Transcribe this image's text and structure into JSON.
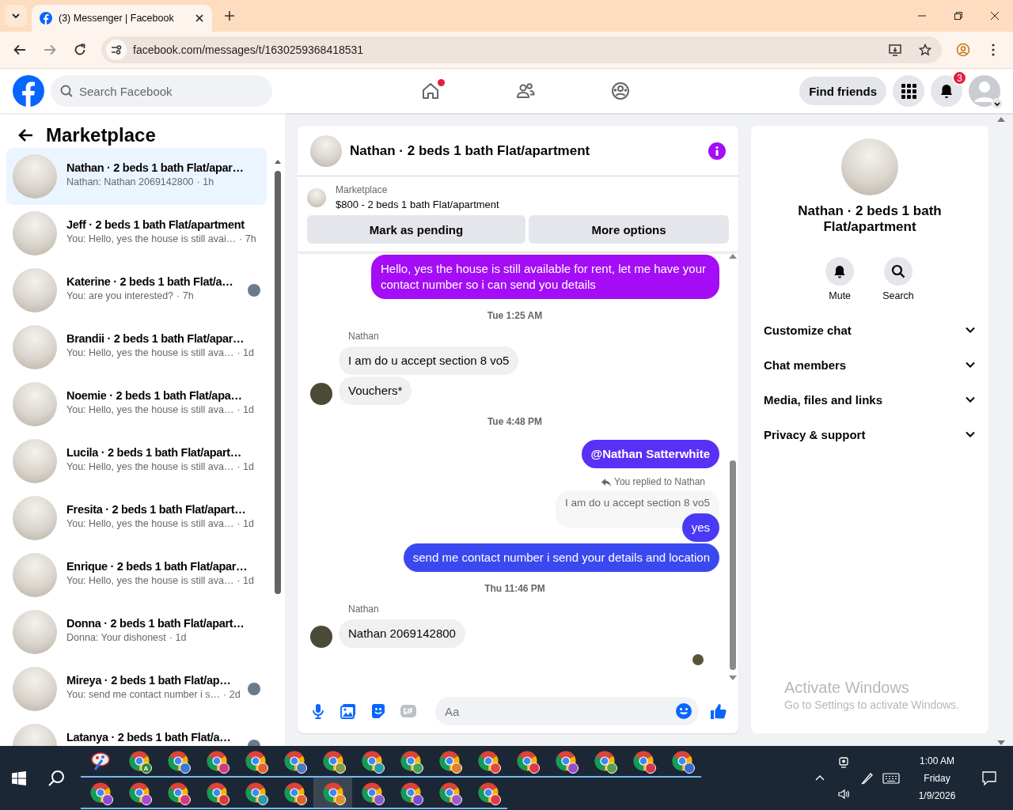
{
  "browser": {
    "tab": {
      "title": "(3) Messenger | Facebook",
      "selected": true
    },
    "url": "facebook.com/messages/t/1630259368418531"
  },
  "header": {
    "search": {
      "placeholder": "Search Facebook"
    },
    "home_notification": true,
    "find_friends": "Find friends",
    "notifications_badge": "3"
  },
  "sidebar": {
    "title": "Marketplace",
    "conversations": [
      {
        "name": "Nathan · 2 beds 1 bath Flat/apar…",
        "preview": "Nathan: Nathan 2069142800",
        "time": "· 1h",
        "selected": true,
        "read_receipt": false
      },
      {
        "name": "Jeff · 2 beds 1 bath Flat/apartment",
        "preview": "You: Hello, yes the house is still avai…",
        "time": "· 7h",
        "selected": false,
        "read_receipt": false
      },
      {
        "name": "Katerine · 2 beds 1 bath Flat/a…",
        "preview": "You: are you interested?",
        "time": "· 7h",
        "selected": false,
        "read_receipt": true
      },
      {
        "name": "Brandii · 2 beds 1 bath Flat/apar…",
        "preview": "You: Hello, yes the house is still ava…",
        "time": "· 1d",
        "selected": false,
        "read_receipt": false
      },
      {
        "name": "Noemie · 2 beds 1 bath Flat/apa…",
        "preview": "You: Hello, yes the house is still ava…",
        "time": "· 1d",
        "selected": false,
        "read_receipt": false
      },
      {
        "name": "Lucila · 2 beds 1 bath Flat/apart…",
        "preview": "You: Hello, yes the house is still ava…",
        "time": "· 1d",
        "selected": false,
        "read_receipt": false
      },
      {
        "name": "Fresita · 2 beds 1 bath Flat/apart…",
        "preview": "You: Hello, yes the house is still ava…",
        "time": "· 1d",
        "selected": false,
        "read_receipt": false
      },
      {
        "name": "Enrique · 2 beds 1 bath Flat/apar…",
        "preview": "You: Hello, yes the house is still ava…",
        "time": "· 1d",
        "selected": false,
        "read_receipt": false
      },
      {
        "name": "Donna · 2 beds 1 bath Flat/apart…",
        "preview": "Donna: Your dishonest",
        "time": "· 1d",
        "selected": false,
        "read_receipt": false
      },
      {
        "name": "Mireya · 2 beds 1 bath Flat/ap…",
        "preview": "You: send me contact number i s…",
        "time": "· 2d",
        "selected": false,
        "read_receipt": true
      },
      {
        "name": "Latanya · 2 beds 1 bath Flat/a…",
        "selected": false,
        "read_receipt": true
      }
    ]
  },
  "chat": {
    "title": "Nathan · 2 beds 1 bath Flat/apartment",
    "listing": {
      "label": "Marketplace",
      "title": "$800 - 2 beds 1 bath Flat/apartment",
      "buttons": [
        "Mark as pending",
        "More options"
      ]
    },
    "messages": [
      {
        "kind": "outgoing",
        "text": "Hello, yes the house is still available for rent, let me have your contact number so i can send you details",
        "color": "#a40df5"
      },
      {
        "kind": "timestamp",
        "text": "Tue 1:25 AM"
      },
      {
        "kind": "incoming",
        "sender": "Nathan",
        "bubbles": [
          "I am do u accept section 8 vo5",
          "Vouchers*"
        ]
      },
      {
        "kind": "timestamp",
        "text": "Tue 4:48 PM"
      },
      {
        "kind": "mention",
        "text": "@Nathan Satterwhite",
        "color": "#5a2ff6"
      },
      {
        "kind": "reply",
        "label": "You replied to Nathan",
        "quote": "I am do u accept section 8 vo5"
      },
      {
        "kind": "outgoing",
        "text": "yes",
        "color": "#4a3af5"
      },
      {
        "kind": "outgoing",
        "text": "send me contact number i send your details and location",
        "color": "#3a48f0"
      },
      {
        "kind": "timestamp",
        "text": "Thu 11:46 PM"
      },
      {
        "kind": "incoming",
        "sender": "Nathan",
        "bubbles": [
          "Nathan 2069142800"
        ]
      }
    ],
    "seen": true,
    "composer": {
      "placeholder": "Aa"
    }
  },
  "info_panel": {
    "title": "Nathan · 2 beds 1 bath Flat/apartment",
    "actions": [
      {
        "kind": "mute",
        "label": "Mute"
      },
      {
        "kind": "search",
        "label": "Search"
      }
    ],
    "sections": [
      {
        "label": "Customize chat",
        "expanded": false
      },
      {
        "label": "Chat members",
        "expanded": false
      },
      {
        "label": "Media, files and links",
        "expanded": false
      },
      {
        "label": "Privacy & support",
        "expanded": false
      }
    ]
  },
  "watermark": {
    "title": "Activate Windows",
    "text": "Go to Settings to activate Windows."
  },
  "taskbar": {
    "app_rows": [
      {
        "apps": [
          {
            "kind": "paint",
            "selected": false
          },
          {
            "kind": "browser",
            "color": "#2e8b3e",
            "letter": "A",
            "selected": false
          },
          {
            "kind": "browser",
            "color": "#3b78d8",
            "selected": false
          },
          {
            "kind": "browser",
            "color": "#d6387f",
            "selected": false
          },
          {
            "kind": "browser",
            "color": "#e0642a",
            "selected": false
          },
          {
            "kind": "browser",
            "color": "#4a7ac8",
            "selected": false
          },
          {
            "kind": "browser",
            "color": "#8c9a3c",
            "selected": false
          },
          {
            "kind": "browser",
            "color": "#2f9aa8",
            "selected": false
          },
          {
            "kind": "browser",
            "color": "#4aa05a",
            "selected": false
          },
          {
            "kind": "browser",
            "color": "#e0802a",
            "selected": false
          },
          {
            "kind": "browser",
            "color": "#e04a3a",
            "selected": false
          },
          {
            "kind": "browser",
            "color": "#d83a4a",
            "selected": false
          },
          {
            "kind": "browser",
            "color": "#9a4ad0",
            "selected": false
          },
          {
            "kind": "browser",
            "color": "#5aa04a",
            "selected": false
          },
          {
            "kind": "browser",
            "color": "#d8344a",
            "selected": false
          },
          {
            "kind": "browser",
            "color": "#3a6ad0",
            "selected": false
          }
        ]
      },
      {
        "apps": [
          {
            "kind": "browser",
            "color": "#8a4ad0",
            "selected": false
          },
          {
            "kind": "browser",
            "color": "#a84ad0",
            "selected": false
          },
          {
            "kind": "browser",
            "color": "#d6387f",
            "selected": false
          },
          {
            "kind": "browser",
            "color": "#d83a3a",
            "selected": false
          },
          {
            "kind": "browser",
            "color": "#2f9aa8",
            "selected": false
          },
          {
            "kind": "browser",
            "color": "#e0642a",
            "selected": false
          },
          {
            "kind": "browser",
            "color": "#e0902a",
            "selected": true
          },
          {
            "kind": "browser",
            "color": "#8a5ad0",
            "selected": false
          },
          {
            "kind": "browser",
            "color": "#7a4ad8",
            "selected": false
          },
          {
            "kind": "browser",
            "color": "#9a5ad0",
            "selected": false
          },
          {
            "kind": "browser",
            "color": "#e03a4a",
            "selected": false
          }
        ]
      }
    ],
    "clock": {
      "time": "1:00 AM",
      "day": "Friday",
      "date": "1/9/2026"
    }
  }
}
